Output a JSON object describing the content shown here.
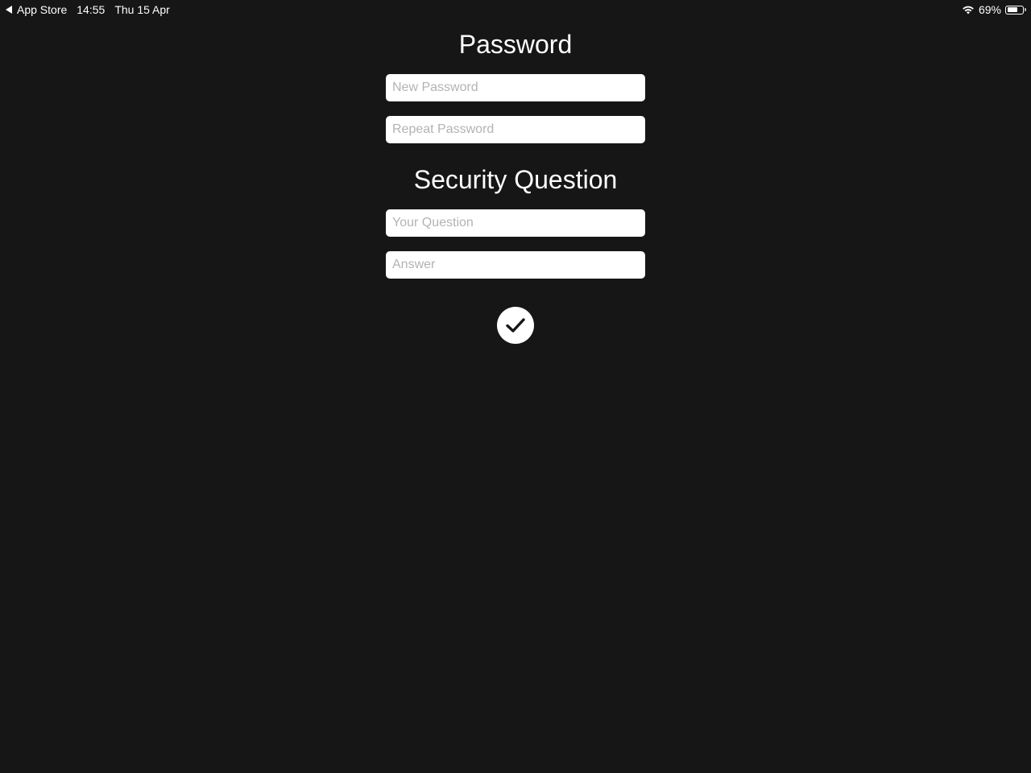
{
  "status_bar": {
    "back_label": "App Store",
    "time": "14:55",
    "date": "Thu 15 Apr",
    "battery_percent": "69%",
    "battery_level": 0.69,
    "icons": [
      "back-arrow-icon",
      "wifi-icon",
      "battery-icon"
    ]
  },
  "password_section": {
    "title": "Password",
    "new_password_placeholder": "New Password",
    "repeat_password_placeholder": "Repeat Password"
  },
  "security_section": {
    "title": "Security Question",
    "question_placeholder": "Your Question",
    "answer_placeholder": "Answer"
  },
  "confirm": {
    "icon": "checkmark-icon"
  },
  "colors": {
    "background": "#161616",
    "text": "#ffffff",
    "field_background": "#ffffff",
    "placeholder": "#b3b3b3"
  }
}
